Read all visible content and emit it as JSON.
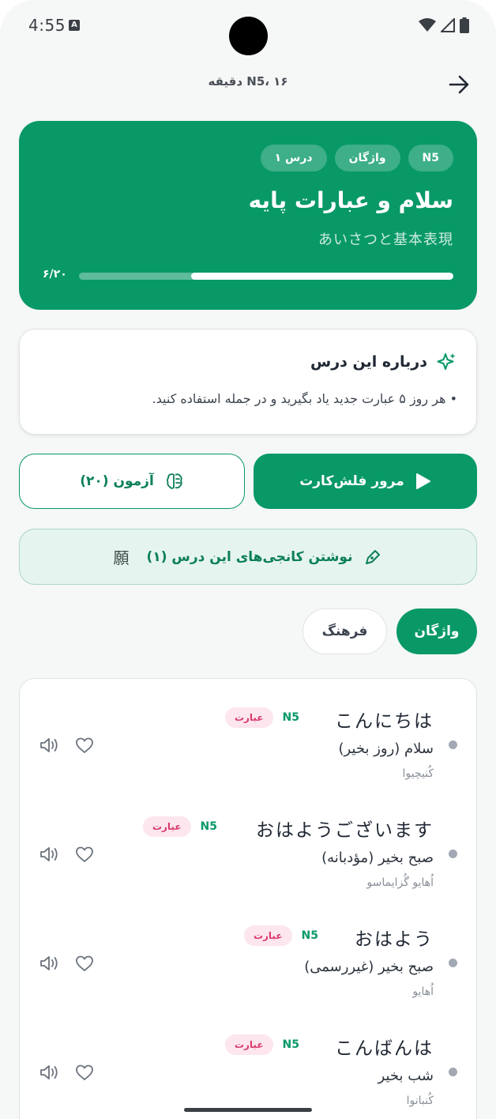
{
  "status_bar": {
    "time": "4:55",
    "notif_glyph": "A"
  },
  "header": {
    "subtitle": "N5، ۱۶ دقیقه"
  },
  "lesson": {
    "chips": [
      "N5",
      "واژگان",
      "درس ۱"
    ],
    "title": "سلام و عبارات پایه",
    "japanese_title": "あいさつと基本表現",
    "progress": {
      "current": 6,
      "total": 20,
      "label": "۶/۲۰"
    }
  },
  "about": {
    "title": "درباره این درس",
    "text": "• هر روز ۵ عبارت جدید یاد بگیرید و در جمله استفاده کنید."
  },
  "actions": {
    "flashcard_label": "مرور فلش‌کارت",
    "quiz_label": "آزمون (۲۰)",
    "kanji_label": "نوشتن کانجی‌های این درس (۱)",
    "kanji_glyph": "願"
  },
  "tabs": [
    {
      "label": "واژگان",
      "active": true
    },
    {
      "label": "فرهنگ",
      "active": false
    }
  ],
  "items": [
    {
      "jp": "こんにちは",
      "level": "N5",
      "type": "عبارت",
      "meaning": "سلام (روز بخیر)",
      "romaji": "کُنیچیوا"
    },
    {
      "jp": "おはようございます",
      "level": "N5",
      "type": "عبارت",
      "meaning": "صبح بخیر (مؤدبانه)",
      "romaji": "اُهایو گُزایماسو"
    },
    {
      "jp": "おはよう",
      "level": "N5",
      "type": "عبارت",
      "meaning": "صبح بخیر (غیررسمی)",
      "romaji": "اُهایو"
    },
    {
      "jp": "こんばんは",
      "level": "N5",
      "type": "عبارت",
      "meaning": "شب بخیر",
      "romaji": "کُنبانوا"
    }
  ],
  "colors": {
    "primary": "#089967",
    "badge_bg": "#fde6ee",
    "badge_text": "#d93b6b"
  },
  "icons": {
    "back": "arrow-right-icon",
    "about": "sparkle-icon",
    "flashcard": "play-icon",
    "quiz": "brain-icon",
    "kanji": "pen-icon",
    "favorite": "heart-icon",
    "audio": "speaker-icon"
  }
}
